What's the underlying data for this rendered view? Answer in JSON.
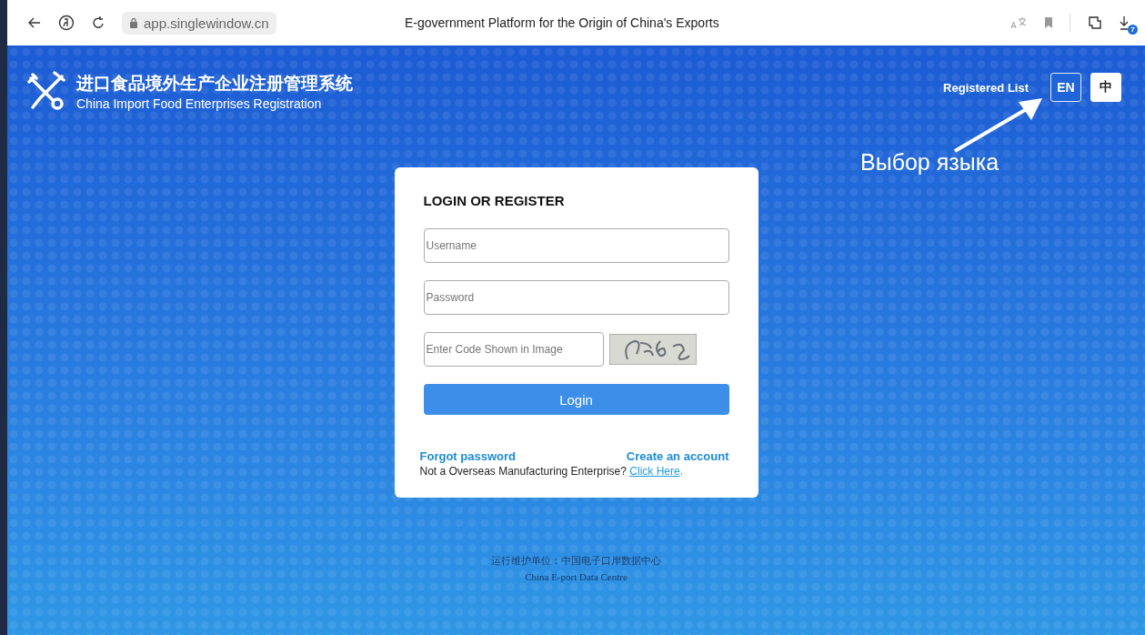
{
  "browser": {
    "address": "app.singlewindow.cn",
    "title": "E-government Platform for the Origin of China's Exports",
    "downloads_badge": "7"
  },
  "header": {
    "title_cn": "进口食品境外生产企业注册管理系统",
    "title_en": "China Import Food Enterprises Registration",
    "registered_list": "Registered List",
    "languages": [
      {
        "label": "EN",
        "selected": true
      },
      {
        "label": "中",
        "selected": false
      }
    ]
  },
  "annotation": "Выбор языка",
  "login": {
    "heading": "LOGIN OR REGISTER",
    "username": {
      "placeholder": "Username"
    },
    "password": {
      "placeholder": "Password"
    },
    "code": {
      "placeholder": "Enter Code Shown in Image"
    },
    "button": "Login",
    "forgot": "Forgot password",
    "create": "Create an account",
    "notice": "Not a Overseas Manufacturing Enterprise?",
    "click_here": "Click Here",
    "notice_end": "."
  },
  "footer": {
    "cn": "运行维护单位：中国电子口岸数据中心",
    "en": "China E-port Data Centre"
  }
}
